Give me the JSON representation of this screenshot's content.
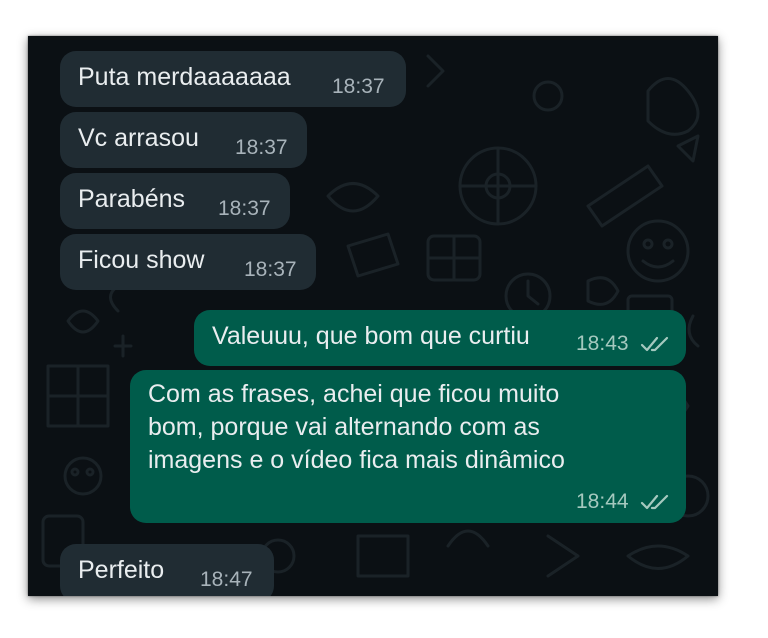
{
  "chat": {
    "messages": [
      {
        "direction": "incoming",
        "text": "Puta merdaaaaaaa",
        "time": "18:37"
      },
      {
        "direction": "incoming",
        "text": "Vc arrasou",
        "time": "18:37"
      },
      {
        "direction": "incoming",
        "text": "Parabéns",
        "time": "18:37"
      },
      {
        "direction": "incoming",
        "text": "Ficou show",
        "time": "18:37"
      },
      {
        "direction": "outgoing",
        "text": "Valeuuu, que bom que curtiu",
        "time": "18:43",
        "status_icon": "double-check-icon"
      },
      {
        "direction": "outgoing",
        "lines": [
          "Com as frases, achei que ficou muito",
          "bom, porque vai alternando com as",
          "imagens e o vídeo fica mais dinâmico"
        ],
        "time": "18:44",
        "status_icon": "double-check-icon"
      },
      {
        "direction": "incoming",
        "text": "Perfeito",
        "time": "18:47"
      }
    ]
  },
  "colors": {
    "background": "#0b1014",
    "incoming_bubble": "#202c33",
    "outgoing_bubble": "#005c4b",
    "message_text": "#e9edef",
    "timestamp": "#a8b3ba",
    "read_ticks": "#a5c9bf"
  }
}
